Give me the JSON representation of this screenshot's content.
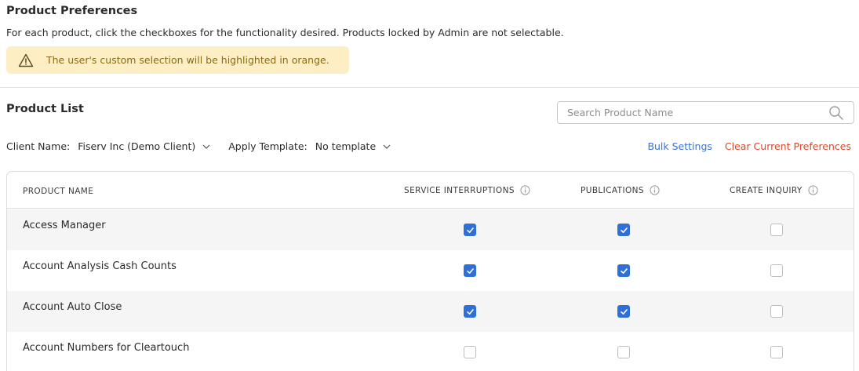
{
  "header": {
    "title": "Product Preferences",
    "subtitle": "For each product, click the checkboxes for the functionality desired. Products locked by Admin are not selectable."
  },
  "alert": {
    "text": "The user's custom selection will be highlighted in orange.",
    "icon": "warning-icon",
    "background_color": "#fdefc3",
    "text_color": "#8a6a14"
  },
  "product_list": {
    "title": "Product List",
    "search_placeholder": "Search Product Name",
    "client_label": "Client Name:",
    "client_value": "Fiserv Inc (Demo Client)",
    "template_label": "Apply Template:",
    "template_value": "No template",
    "bulk_settings": "Bulk Settings",
    "clear_preferences": "Clear Current Preferences",
    "link_color": "#3a73d6",
    "danger_color": "#d9482b"
  },
  "table": {
    "columns": {
      "product_name": "PRODUCT NAME",
      "service_interruptions": "SERVICE INTERRUPTIONS",
      "publications": "PUBLICATIONS",
      "create_inquiry": "CREATE INQUIRY"
    },
    "rows": [
      {
        "name": "Access Manager",
        "service_interruptions": true,
        "publications": true,
        "create_inquiry": false
      },
      {
        "name": "Account Analysis Cash Counts",
        "service_interruptions": true,
        "publications": true,
        "create_inquiry": false
      },
      {
        "name": "Account Auto Close",
        "service_interruptions": true,
        "publications": true,
        "create_inquiry": false
      },
      {
        "name": "Account Numbers for Cleartouch",
        "service_interruptions": false,
        "publications": false,
        "create_inquiry": false
      }
    ],
    "checkbox_color": "#2f6fd8"
  }
}
